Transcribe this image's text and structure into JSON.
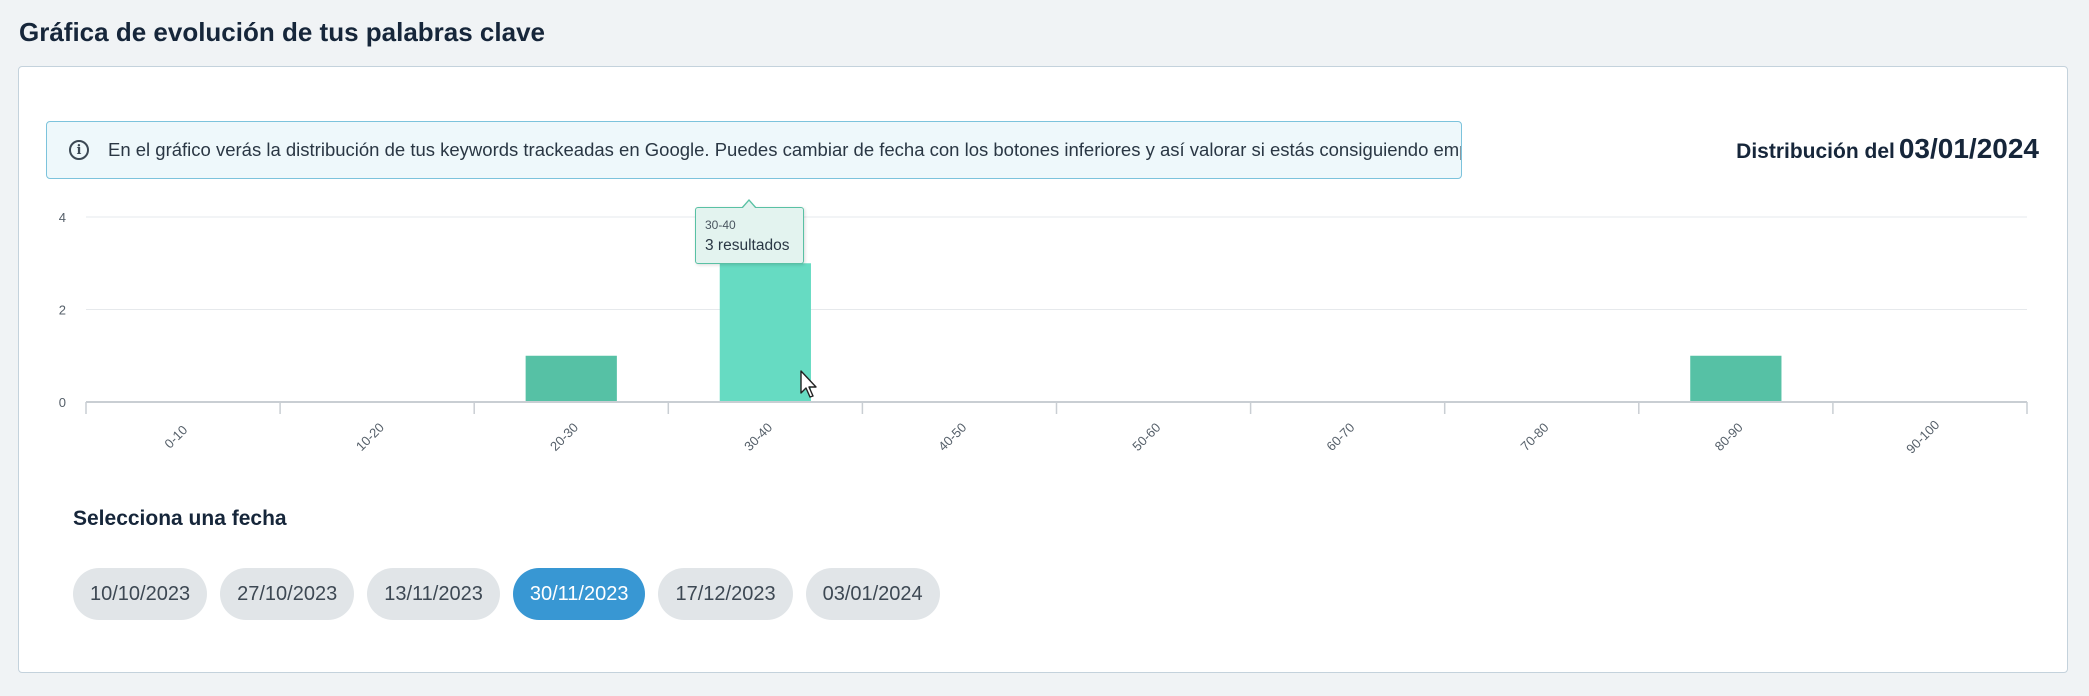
{
  "page": {
    "title": "Gráfica de evolución de tus palabras clave"
  },
  "info": {
    "icon": "info-icon",
    "text": "En el gráfico verás la distribución de tus keywords trackeadas en Google. Puedes cambiar de fecha con los botones inferiores y así valorar si estás consiguiendo empujarlas."
  },
  "distribution": {
    "label": "Distribución del",
    "date": "03/01/2024"
  },
  "chart_data": {
    "type": "bar",
    "title": "",
    "xlabel": "",
    "ylabel": "",
    "categories": [
      "0-10",
      "10-20",
      "20-30",
      "30-40",
      "40-50",
      "50-60",
      "60-70",
      "70-80",
      "80-90",
      "90-100"
    ],
    "values": [
      0,
      0,
      1,
      3,
      0,
      0,
      0,
      0,
      1,
      0
    ],
    "ylim": [
      0,
      4
    ],
    "yticks": [
      0,
      2,
      4
    ],
    "grid": true,
    "legend": "none",
    "bar_color": "#56c1a5",
    "highlight_color": "#66dbc2",
    "highlighted_category": "30-40"
  },
  "tooltip": {
    "category": "30-40",
    "value_text": "3 resultados"
  },
  "date_selector": {
    "label": "Selecciona una fecha",
    "dates": [
      "10/10/2023",
      "27/10/2023",
      "13/11/2023",
      "30/11/2023",
      "17/12/2023",
      "03/01/2024"
    ],
    "active_index": 3
  },
  "colors": {
    "accent": "#3897d3",
    "info_border": "#7cc3dc"
  }
}
